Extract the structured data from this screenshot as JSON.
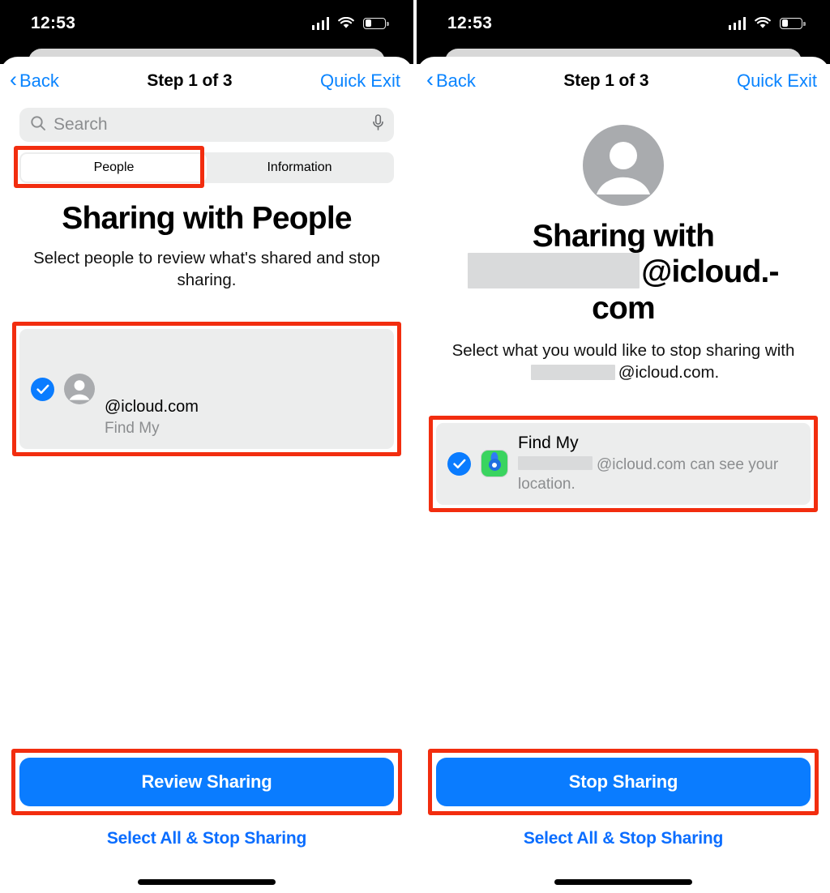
{
  "status_bar": {
    "time": "12:53",
    "signal_icon": "cellular-signal-icon",
    "wifi_icon": "wifi-icon",
    "battery_icon": "battery-low-icon"
  },
  "nav": {
    "back_label": "Back",
    "title": "Step 1 of 3",
    "quick_exit_label": "Quick Exit"
  },
  "colors": {
    "accent_blue": "#0a7cff",
    "link_blue": "#0a84ff",
    "highlight_red": "#f22d0f",
    "row_grey": "#eceded",
    "redaction_grey": "#d9dadb",
    "find_my_green": "#3ad45f"
  },
  "left_panel": {
    "search": {
      "placeholder": "Search",
      "search_icon": "magnifier-icon",
      "mic_icon": "microphone-icon"
    },
    "segmented": {
      "options": [
        "People",
        "Information"
      ],
      "selected": "People"
    },
    "heading": "Sharing with People",
    "subheading": "Select people to review what's shared and stop sharing.",
    "person_row": {
      "checked": true,
      "avatar_icon": "person-avatar-icon",
      "email_suffix": "@icloud.com",
      "detail": "Find My"
    },
    "primary_button": "Review Sharing",
    "secondary_link": "Select All & Stop Sharing"
  },
  "right_panel": {
    "avatar_icon": "person-avatar-icon",
    "heading_prefix": "Sharing with",
    "heading_suffix": "@icloud.-com",
    "subheading_before": "Select what you would like to stop sharing with",
    "subheading_after": "@icloud.com.",
    "app_row": {
      "checked": true,
      "app_icon": "find-my-app-icon",
      "title": "Find My",
      "detail_before": "",
      "detail_after": "@icloud.com can see your location."
    },
    "primary_button": "Stop Sharing",
    "secondary_link": "Select All & Stop Sharing"
  }
}
